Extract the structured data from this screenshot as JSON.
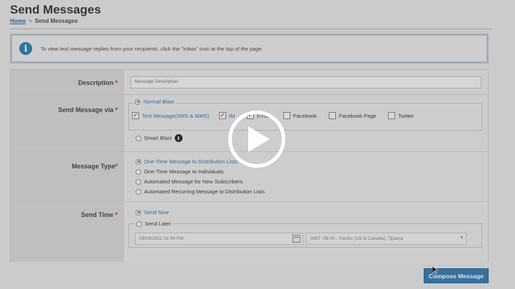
{
  "page": {
    "title": "Send Messages",
    "breadcrumb": {
      "home": "Home",
      "separator": ">",
      "current": "Send Messages"
    }
  },
  "info_banner": {
    "icon": "info-icon",
    "text": "To view text message replies from your recipients, click the \"Inbox\" icon at the top of the page."
  },
  "form": {
    "description": {
      "label": "Description",
      "required": "*",
      "placeholder": "Message Description"
    },
    "send_via": {
      "label": "Send Message via",
      "required": "*",
      "normal_blast": "Normal Blast",
      "channels": [
        {
          "label": "Text Message(SMS & MMS)",
          "checked": true
        },
        {
          "label": "IM",
          "checked": true
        },
        {
          "label": "Email",
          "checked": true
        },
        {
          "label": "Facebook",
          "checked": false
        },
        {
          "label": "Facebook Page",
          "checked": false
        },
        {
          "label": "Twitter",
          "checked": false
        }
      ],
      "smart_blast": "Smart Blast",
      "smart_blast_info_icon": "info-icon"
    },
    "message_type": {
      "label": "Message Type",
      "required": "*",
      "options": [
        {
          "label": "One-Time Message to Distribution Lists",
          "selected": true
        },
        {
          "label": "One-Time Message to Individuals",
          "selected": false
        },
        {
          "label": "Automated Message for New Subscribers",
          "selected": false
        },
        {
          "label": "Automated Recurring Message to Distribution Lists",
          "selected": false
        }
      ]
    },
    "send_time": {
      "label": "Send Time",
      "required": "*",
      "send_now": "Send Now",
      "send_later": "Send Later",
      "date_value": "09/09/2022 01:44 PM",
      "timezone": "GMT -08:00 - Pacific (US & Canada); Tijuana"
    }
  },
  "compose_button": "Compose Message",
  "overlay": {
    "play_icon": "play-icon"
  },
  "colors": {
    "accent": "#2d6fa3",
    "required": "#b02020",
    "label_bg": "#c9c9c9"
  }
}
